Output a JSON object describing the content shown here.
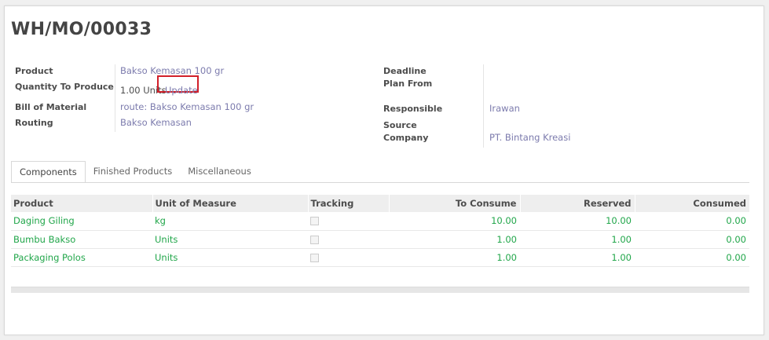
{
  "record": {
    "title": "WH/MO/00033"
  },
  "left_fields": {
    "product_label": "Product",
    "product_value": "Bakso Kemasan 100 gr",
    "qty_label": "Quantity To Produce",
    "qty_value": "1.00 Units",
    "update_label": "Update",
    "bom_label": "Bill of Material",
    "bom_value": "route: Bakso Kemasan 100 gr",
    "routing_label": "Routing",
    "routing_value": "Bakso Kemasan"
  },
  "right_fields": {
    "deadline_label": "Deadline",
    "deadline_value": "",
    "plan_from_label": "Plan From",
    "plan_from_value": "",
    "responsible_label": "Responsible",
    "responsible_value": "Irawan",
    "source_label": "Source",
    "company_label": "Company",
    "company_value": "PT. Bintang Kreasi"
  },
  "tabs": [
    {
      "label": "Components",
      "active": true
    },
    {
      "label": "Finished Products",
      "active": false
    },
    {
      "label": "Miscellaneous",
      "active": false
    }
  ],
  "components_table": {
    "columns": [
      "Product",
      "Unit of Measure",
      "Tracking",
      "To Consume",
      "Reserved",
      "Consumed"
    ],
    "rows": [
      {
        "product": "Daging Giling",
        "uom": "kg",
        "tracking": false,
        "to_consume": "10.00",
        "reserved": "10.00",
        "consumed": "0.00"
      },
      {
        "product": "Bumbu Bakso",
        "uom": "Units",
        "tracking": false,
        "to_consume": "1.00",
        "reserved": "1.00",
        "consumed": "0.00"
      },
      {
        "product": "Packaging Polos",
        "uom": "Units",
        "tracking": false,
        "to_consume": "1.00",
        "reserved": "1.00",
        "consumed": "0.00"
      }
    ]
  },
  "colors": {
    "accent_link": "#7c7bad",
    "row_text": "#21a64a",
    "highlight_box": "#d2202a"
  }
}
